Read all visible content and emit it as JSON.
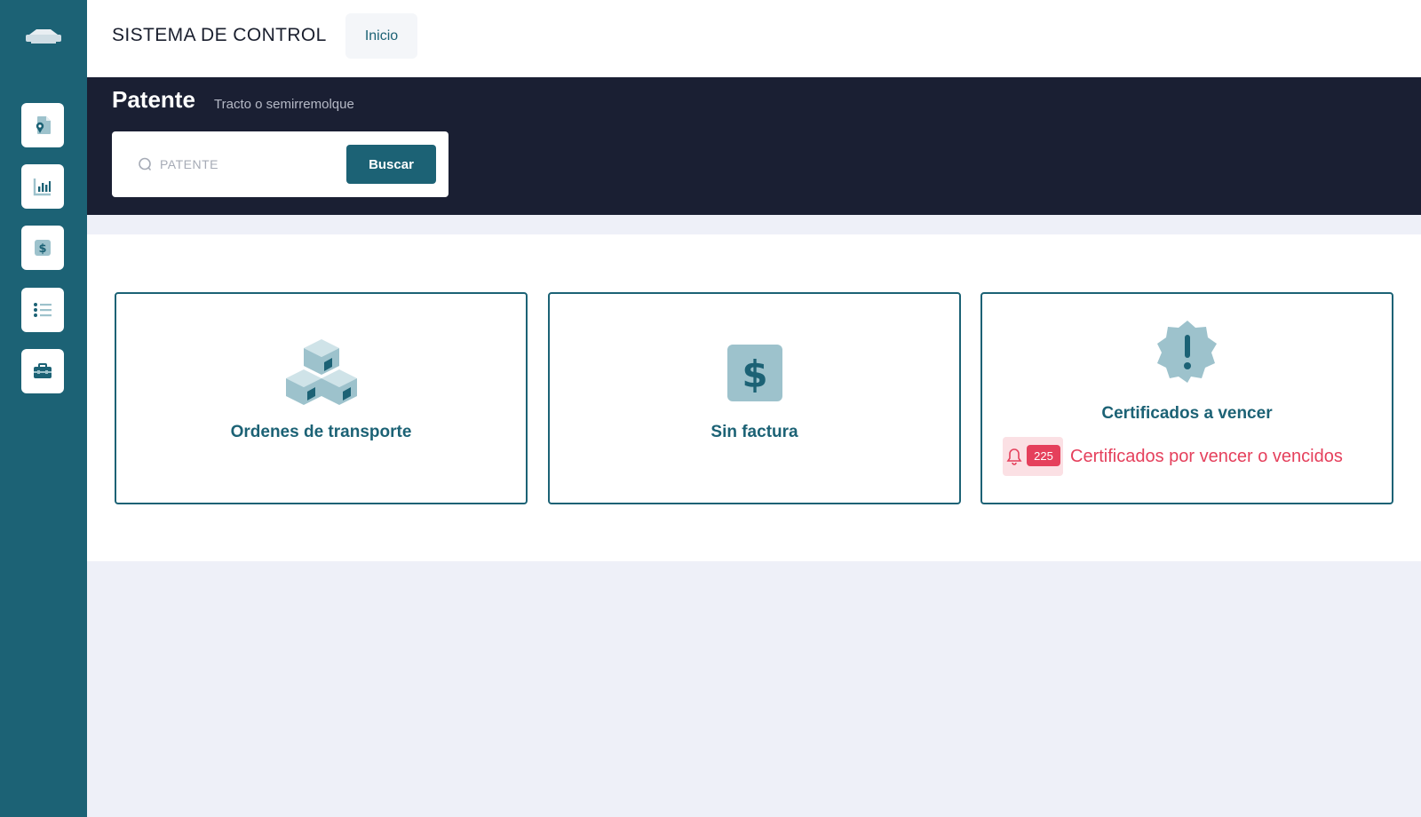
{
  "topbar": {
    "app_title": "SISTEMA DE CONTROL",
    "tab_inicio": "Inicio"
  },
  "sidebar": {
    "items": [
      {
        "icon": "document-location-icon"
      },
      {
        "icon": "bar-chart-icon"
      },
      {
        "icon": "dollar-icon"
      },
      {
        "icon": "list-icon"
      },
      {
        "icon": "toolbox-icon"
      }
    ]
  },
  "hero": {
    "title": "Patente",
    "subtitle": "Tracto o semirremolque",
    "search_placeholder": "PATENTE",
    "search_value": "",
    "search_button": "Buscar"
  },
  "cards": [
    {
      "label": "Ordenes de transporte",
      "icon": "boxes-icon"
    },
    {
      "label": "Sin factura",
      "icon": "dollar-square-icon"
    },
    {
      "label": "Certificados a vencer",
      "icon": "alert-badge-icon",
      "alert_count": "225",
      "alert_text": "Certificados por vencer o vencidos"
    }
  ],
  "colors": {
    "primary": "#1c6275",
    "dark_header": "#1a1f33",
    "alert": "#e5405c",
    "icon_light": "#9dc2cc",
    "background": "#eef0f8"
  }
}
